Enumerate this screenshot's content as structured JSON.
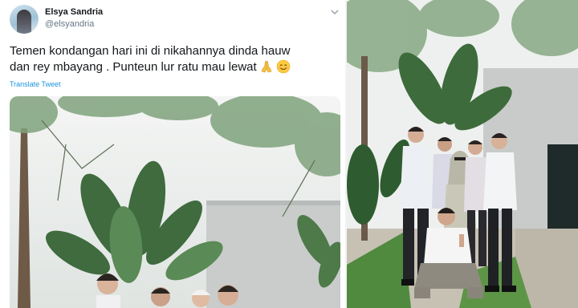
{
  "tweet": {
    "display_name": "Elsya Sandria",
    "handle": "@elsyandria",
    "text_line1": "Temen kondangan hari ini di nikahannya dinda hauw",
    "text_line2": "dan rey mbayang . Punteun lur ratu mau lewat",
    "emojis": [
      "folded-hands-emoji",
      "smiling-face-emoji"
    ],
    "translate_label": "Translate Tweet",
    "menu_icon": "chevron-down-icon"
  },
  "colors": {
    "text": "#14171a",
    "secondary": "#657786",
    "link": "#1b95e0"
  }
}
